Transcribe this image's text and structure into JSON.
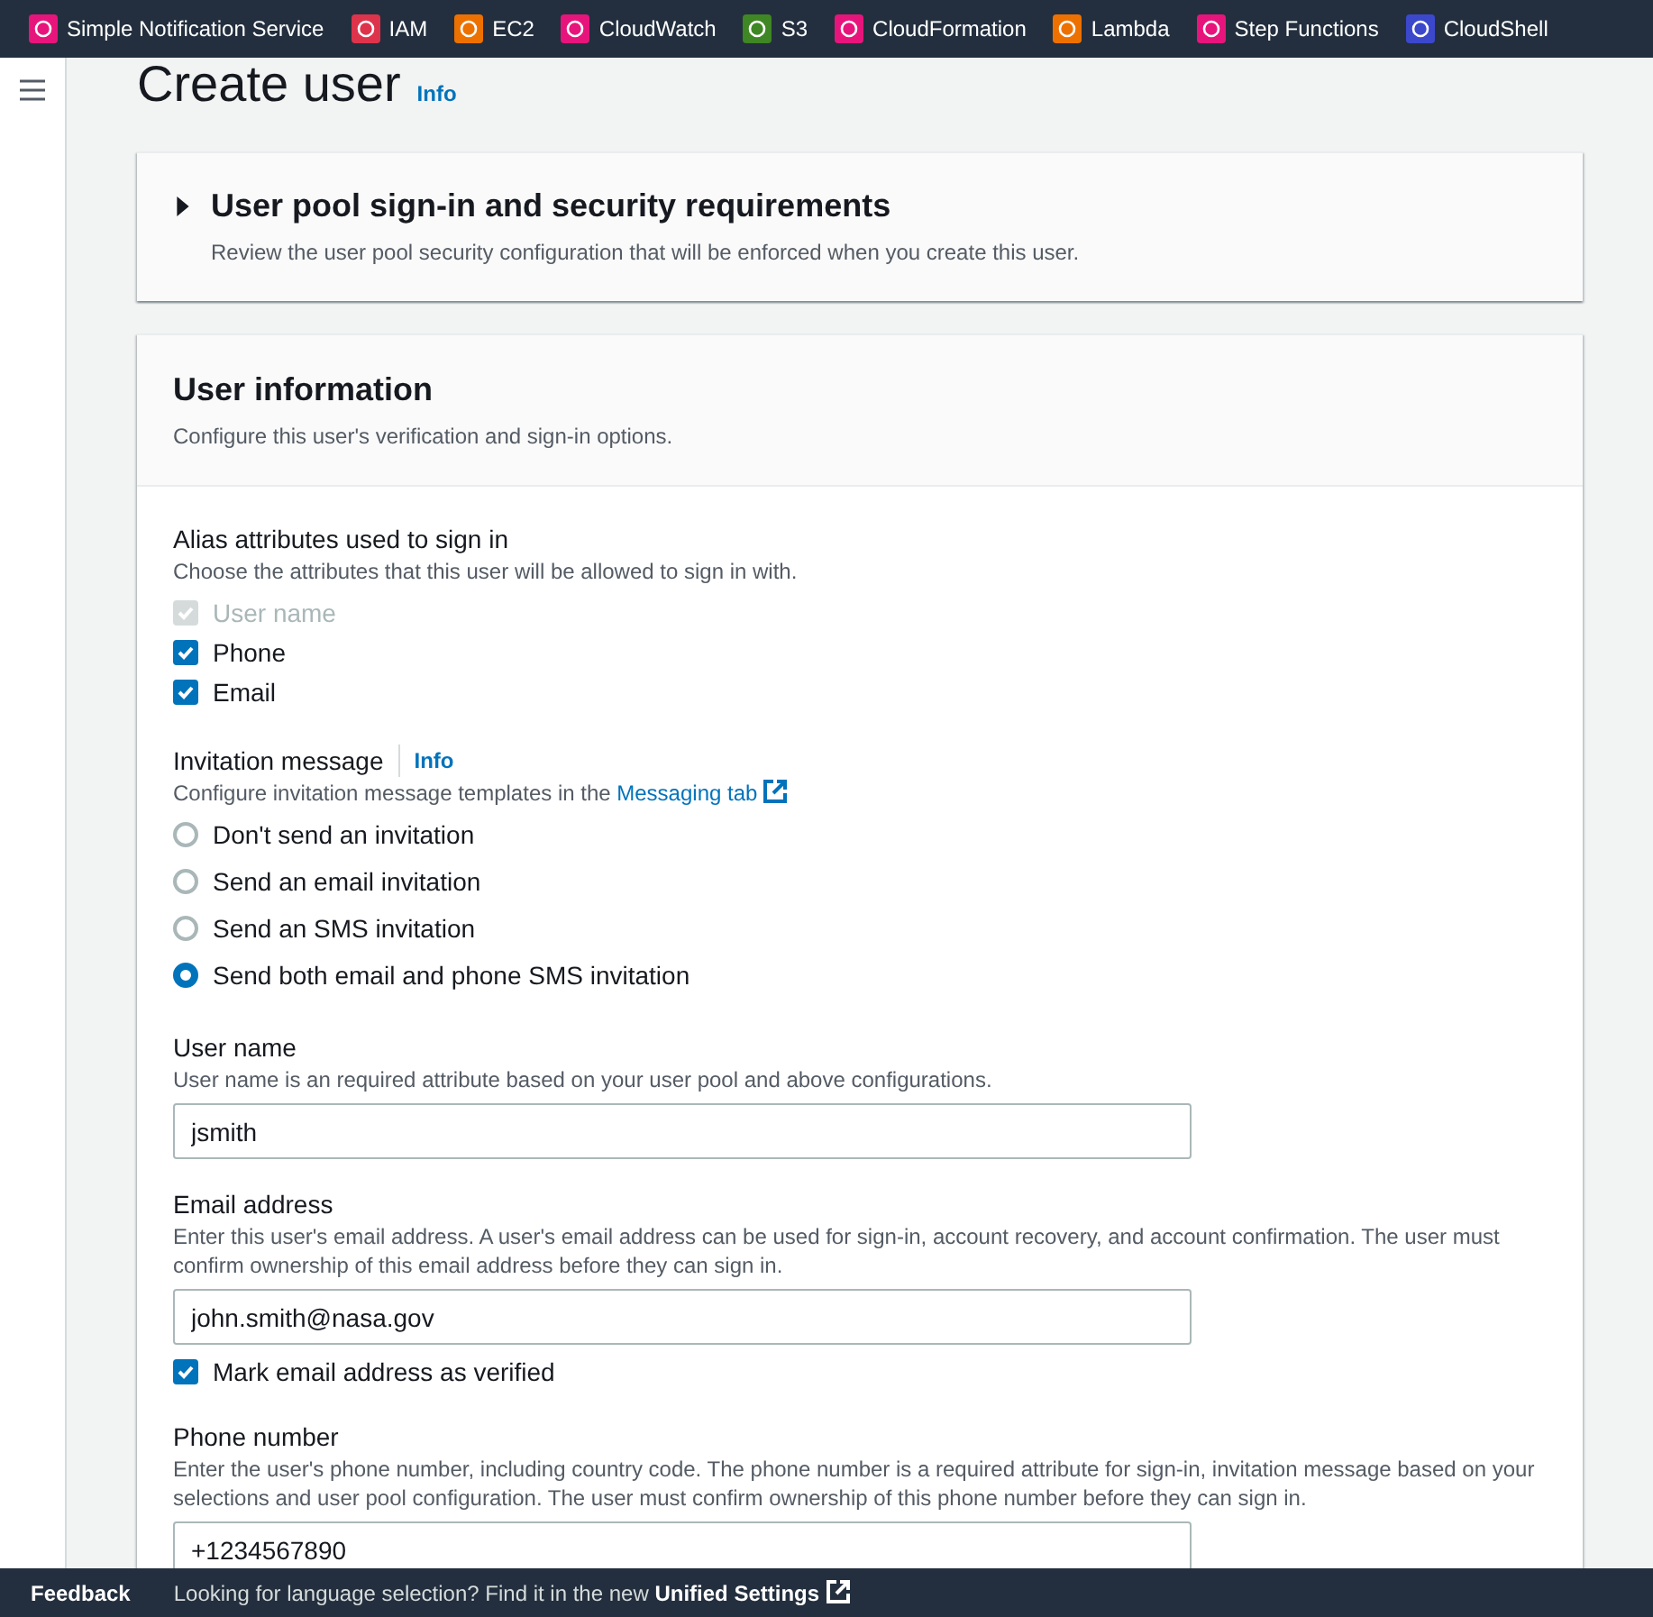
{
  "top_nav": {
    "services": [
      {
        "label": "Simple Notification Service",
        "color": "#e7157b"
      },
      {
        "label": "IAM",
        "color": "#dd344c"
      },
      {
        "label": "EC2",
        "color": "#ed7100"
      },
      {
        "label": "CloudWatch",
        "color": "#e7157b"
      },
      {
        "label": "S3",
        "color": "#3f8624"
      },
      {
        "label": "CloudFormation",
        "color": "#e7157b"
      },
      {
        "label": "Lambda",
        "color": "#ed7100"
      },
      {
        "label": "Step Functions",
        "color": "#e7157b"
      },
      {
        "label": "CloudShell",
        "color": "#3b48cc"
      }
    ]
  },
  "page": {
    "title": "Create user",
    "info_link": "Info"
  },
  "security_panel": {
    "title": "User pool sign-in and security requirements",
    "description": "Review the user pool security configuration that will be enforced when you create this user.",
    "expanded": false
  },
  "user_information": {
    "title": "User information",
    "description": "Configure this user's verification and sign-in options.",
    "alias": {
      "label": "Alias attributes used to sign in",
      "description": "Choose the attributes that this user will be allowed to sign in with.",
      "options": [
        {
          "label": "User name",
          "checked": true,
          "disabled": true
        },
        {
          "label": "Phone",
          "checked": true,
          "disabled": false
        },
        {
          "label": "Email",
          "checked": true,
          "disabled": false
        }
      ]
    },
    "invitation": {
      "label": "Invitation message",
      "info_link": "Info",
      "description": "Configure invitation message templates in the ",
      "link": "Messaging tab",
      "options": [
        {
          "label": "Don't send an invitation",
          "selected": false
        },
        {
          "label": "Send an email invitation",
          "selected": false
        },
        {
          "label": "Send an SMS invitation",
          "selected": false
        },
        {
          "label": "Send both email and phone SMS invitation",
          "selected": true
        }
      ]
    },
    "fields": [
      {
        "label": "User name",
        "description": "User name is an required attribute based on your user pool and above configurations.",
        "value": "jsmith"
      },
      {
        "label": "Email address",
        "description": "Enter this user's email address. A user's email address can be used for sign-in, account recovery, and account confirmation. The user must confirm ownership of this email address before they can sign in.",
        "value": "john.smith@nasa.gov",
        "checkbox": {
          "label": "Mark email address as verified",
          "checked": true
        }
      },
      {
        "label": "Phone number",
        "description": "Enter the user's phone number, including country code. The phone number is a required attribute for sign-in, invitation message based on your selections and user pool configuration. The user must confirm ownership of this phone number before they can sign in.",
        "value": "+1234567890"
      }
    ]
  },
  "footer": {
    "feedback": "Feedback",
    "message": "Looking for language selection? Find it in the new ",
    "link": "Unified Settings"
  }
}
